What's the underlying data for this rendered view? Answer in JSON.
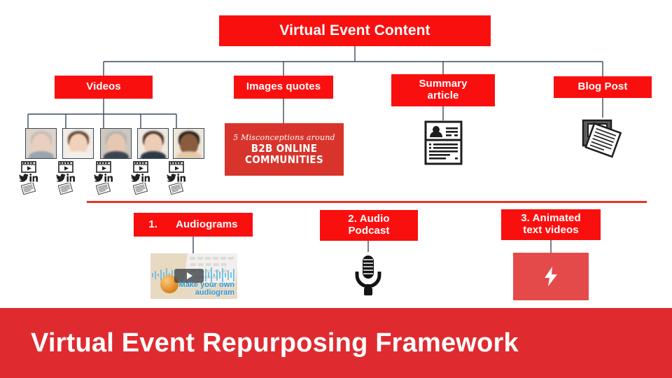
{
  "root": {
    "label": "Virtual Event Content"
  },
  "level2": [
    {
      "label": "Videos",
      "name": "videos"
    },
    {
      "label": "Images quotes",
      "name": "images-quotes"
    },
    {
      "label_line1": "Summary",
      "label_line2": "article",
      "name": "summary-article"
    },
    {
      "label": "Blog Post",
      "name": "blog-post"
    }
  ],
  "videos": {
    "thumbnails": [
      {
        "alt": "woman smiling headshot",
        "hair": "#c9bdb4",
        "skin": "#e8cfc0",
        "shirt": "#9aa3ad",
        "bg": "#ded3c9"
      },
      {
        "alt": "woman with long brown hair headshot",
        "hair": "#6b4a36",
        "skin": "#f0d2bb",
        "shirt": "#f3efe9",
        "bg": "#f2ece4"
      },
      {
        "alt": "older man in suit headshot",
        "hair": "#b8b4b0",
        "skin": "#e6c7b2",
        "shirt": "#3c4450",
        "bg": "#cfc6bd"
      },
      {
        "alt": "woman with glasses headshot",
        "hair": "#4b3527",
        "skin": "#eccdb6",
        "shirt": "#2f3946",
        "bg": "#efe9e2"
      },
      {
        "alt": "woman with curly hair headshot",
        "hair": "#2a2220",
        "skin": "#8a5c3f",
        "shirt": "#e3c9a8",
        "bg": "#efe6d8"
      }
    ],
    "icons": [
      "video-player-icon",
      "twitter-icon",
      "linkedin-icon",
      "newspaper-icon"
    ]
  },
  "quote_card": {
    "script_line": "5 Misconceptions around",
    "headline_line1": "B2B ONLINE",
    "headline_line2": "COMMUNITIES"
  },
  "summary_article": {
    "icon": "article-document-icon"
  },
  "blog_post": {
    "icon": "newspaper-stack-icon"
  },
  "repurposing": [
    {
      "number": "1.",
      "label": "Audiograms",
      "name": "audiograms"
    },
    {
      "label_line1": "2. Audio",
      "label_line2": "Podcast",
      "name": "audio-podcast"
    },
    {
      "label_line1": "3. Animated",
      "label_line2": "text videos",
      "name": "animated-text-videos"
    }
  ],
  "audiogram_thumb": {
    "caption_line1": "Make your own",
    "caption_line2": "audiogram",
    "icon": "play-button-icon"
  },
  "podcast_thumb": {
    "icon": "microphone-icon"
  },
  "animated_thumb": {
    "icon": "lightning-bolt-icon"
  },
  "banner": {
    "title": "Virtual Event Repurposing Framework"
  },
  "colors": {
    "box_red": "#fa0f0f",
    "banner_red": "#df2b30",
    "divider_red": "#e8342c",
    "connector": "#3b4a5a",
    "quote_card_red": "#d8342c",
    "anim_panel_red": "#e44a4a"
  }
}
